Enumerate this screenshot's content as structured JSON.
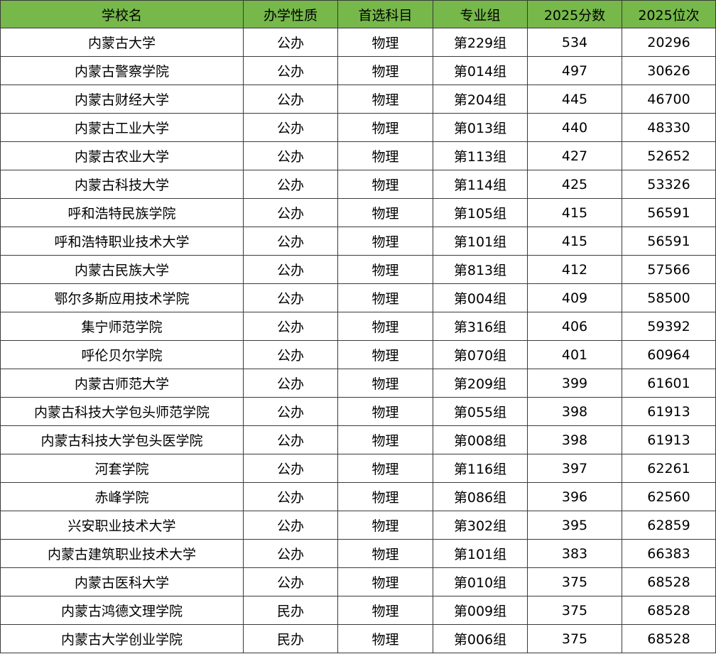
{
  "colors": {
    "header_bg": "#76b84a",
    "border": "#3a3a3a",
    "text": "#000000"
  },
  "table": {
    "headers": [
      "学校名",
      "办学性质",
      "首选科目",
      "专业组",
      "2025分数",
      "2025位次"
    ],
    "rows": [
      [
        "内蒙古大学",
        "公办",
        "物理",
        "第229组",
        "534",
        "20296"
      ],
      [
        "内蒙古警察学院",
        "公办",
        "物理",
        "第014组",
        "497",
        "30626"
      ],
      [
        "内蒙古财经大学",
        "公办",
        "物理",
        "第204组",
        "445",
        "46700"
      ],
      [
        "内蒙古工业大学",
        "公办",
        "物理",
        "第013组",
        "440",
        "48330"
      ],
      [
        "内蒙古农业大学",
        "公办",
        "物理",
        "第113组",
        "427",
        "52652"
      ],
      [
        "内蒙古科技大学",
        "公办",
        "物理",
        "第114组",
        "425",
        "53326"
      ],
      [
        "呼和浩特民族学院",
        "公办",
        "物理",
        "第105组",
        "415",
        "56591"
      ],
      [
        "呼和浩特职业技术大学",
        "公办",
        "物理",
        "第101组",
        "415",
        "56591"
      ],
      [
        "内蒙古民族大学",
        "公办",
        "物理",
        "第813组",
        "412",
        "57566"
      ],
      [
        "鄂尔多斯应用技术学院",
        "公办",
        "物理",
        "第004组",
        "409",
        "58500"
      ],
      [
        "集宁师范学院",
        "公办",
        "物理",
        "第316组",
        "406",
        "59392"
      ],
      [
        "呼伦贝尔学院",
        "公办",
        "物理",
        "第070组",
        "401",
        "60964"
      ],
      [
        "内蒙古师范大学",
        "公办",
        "物理",
        "第209组",
        "399",
        "61601"
      ],
      [
        "内蒙古科技大学包头师范学院",
        "公办",
        "物理",
        "第055组",
        "398",
        "61913"
      ],
      [
        "内蒙古科技大学包头医学院",
        "公办",
        "物理",
        "第008组",
        "398",
        "61913"
      ],
      [
        "河套学院",
        "公办",
        "物理",
        "第116组",
        "397",
        "62261"
      ],
      [
        "赤峰学院",
        "公办",
        "物理",
        "第086组",
        "396",
        "62560"
      ],
      [
        "兴安职业技术大学",
        "公办",
        "物理",
        "第302组",
        "395",
        "62859"
      ],
      [
        "内蒙古建筑职业技术大学",
        "公办",
        "物理",
        "第101组",
        "383",
        "66383"
      ],
      [
        "内蒙古医科大学",
        "公办",
        "物理",
        "第010组",
        "375",
        "68528"
      ],
      [
        "内蒙古鸿德文理学院",
        "民办",
        "物理",
        "第009组",
        "375",
        "68528"
      ],
      [
        "内蒙古大学创业学院",
        "民办",
        "物理",
        "第006组",
        "375",
        "68528"
      ]
    ]
  }
}
